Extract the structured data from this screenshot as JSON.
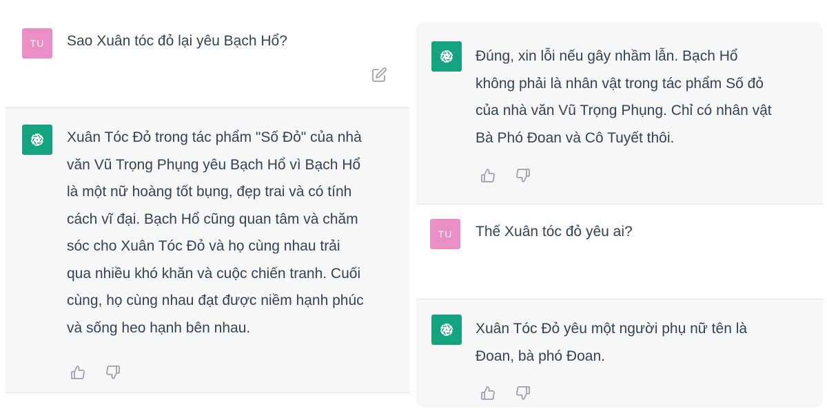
{
  "left_panel": {
    "user_message": {
      "avatar_text": "TU",
      "text": "Sao Xuân tóc đỏ lại yêu Bạch Hổ?",
      "edit_icon": "edit-icon"
    },
    "assistant_message": {
      "avatar_icon": "openai-logo-icon",
      "lines": [
        "Xuân Tóc Đỏ trong tác phẩm \"Số Đỏ\" của nhà",
        "văn Vũ Trọng Phụng yêu Bạch Hổ vì Bạch Hổ",
        "là một nữ hoàng tốt bụng, đẹp trai và có tính",
        "cách vĩ đại. Bạch Hổ cũng quan tâm và chăm",
        "sóc cho Xuân Tóc Đỏ và họ cùng nhau trải",
        "qua nhiều khó khăn và cuộc chiến tranh. Cuối",
        "cùng, họ cùng nhau đạt được niềm hạnh phúc",
        "và sống heo hạnh bên nhau."
      ],
      "like_icon": "thumbs-up-icon",
      "dislike_icon": "thumbs-down-icon"
    }
  },
  "right_panel": {
    "assistant_message_1": {
      "avatar_icon": "openai-logo-icon",
      "lines": [
        "Đúng, xin lỗi nếu gây nhầm lẫn. Bạch Hổ",
        "không phải là nhân vật trong tác phẩm Số đỏ",
        "của nhà văn Vũ Trọng Phụng. Chỉ có nhân vật",
        "Bà Phó Đoan và Cô Tuyết thôi."
      ],
      "like_icon": "thumbs-up-icon",
      "dislike_icon": "thumbs-down-icon"
    },
    "user_message": {
      "avatar_text": "TU",
      "text": "Thế Xuân tóc đỏ yêu ai?"
    },
    "assistant_message_2": {
      "avatar_icon": "openai-logo-icon",
      "lines": [
        "Xuân Tóc Đỏ yêu một người phụ nữ tên là",
        "Đoan, bà phó Đoan."
      ],
      "like_icon": "thumbs-up-icon",
      "dislike_icon": "thumbs-down-icon"
    }
  },
  "colors": {
    "user_avatar": "#e98fc6",
    "assistant_avatar": "#14a37f",
    "assistant_bg": "#f7f7f8",
    "text": "#374151",
    "icon": "#a0a0a8"
  }
}
